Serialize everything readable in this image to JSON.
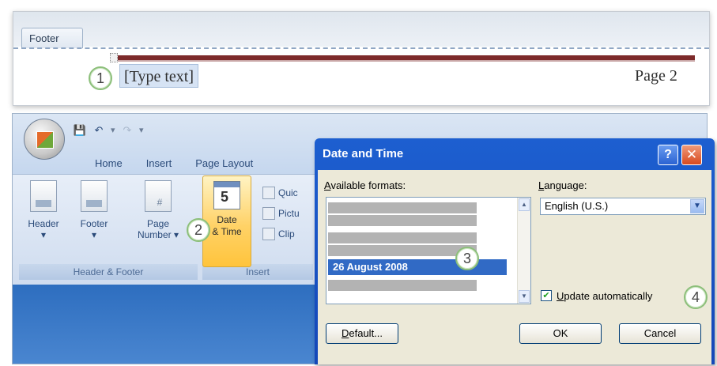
{
  "footer_panel": {
    "tab_label": "Footer",
    "placeholder_text": "[Type text]",
    "page_text": "Page 2"
  },
  "callouts": [
    "1",
    "2",
    "3",
    "4"
  ],
  "ribbon": {
    "quick_access": {
      "save_icon": "save-icon",
      "undo_icon": "undo-icon",
      "redo_icon": "redo-icon",
      "customize": "▾"
    },
    "tabs": [
      "Home",
      "Insert",
      "Page Layout"
    ],
    "groups": {
      "header_footer": {
        "label": "Header & Footer",
        "buttons": {
          "header": "Header",
          "footer": "Footer",
          "page_number_1": "Page",
          "page_number_2": "Number"
        }
      },
      "insert": {
        "label": "Insert",
        "date_time_1": "Date",
        "date_time_2": "& Time",
        "calendar_number": "5",
        "quick": "Quic",
        "picture": "Pictu",
        "clip": "Clip"
      }
    }
  },
  "dialog": {
    "title": "Date and Time",
    "help": "?",
    "close": "✕",
    "available_formats_label": "Available formats:",
    "language_label": "Language:",
    "selected_format": "26 August 2008",
    "language_value": "English (U.S.)",
    "update_automatically_label": "Update automatically",
    "update_automatically_checked": true,
    "buttons": {
      "default": "Default...",
      "ok": "OK",
      "cancel": "Cancel"
    }
  },
  "colors": {
    "accent_blue": "#1d5fd0",
    "selection": "#316ac5",
    "footer_rule": "#7d2a2a",
    "callout_ring": "#8cbf7a",
    "date_time_highlight": "#ffd267"
  }
}
